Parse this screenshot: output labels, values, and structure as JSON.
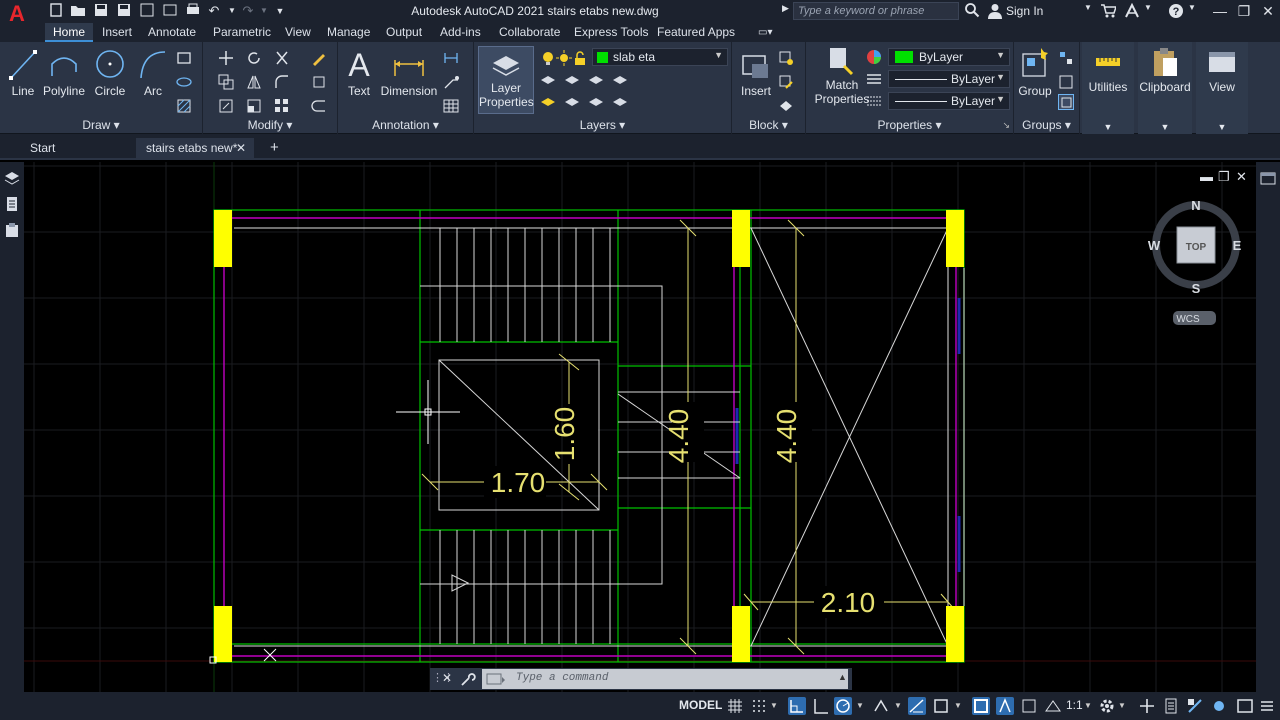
{
  "app": {
    "logo": "A",
    "title": "Autodesk AutoCAD 2021   stairs etabs new.dwg",
    "search_placeholder": "Type a keyword or phrase",
    "signin_label": "Sign In"
  },
  "ribbon_tabs": [
    "Home",
    "Insert",
    "Annotate",
    "Parametric",
    "View",
    "Manage",
    "Output",
    "Add-ins",
    "Collaborate",
    "Express Tools",
    "Featured Apps"
  ],
  "ribbon": {
    "draw": {
      "title": "Draw",
      "tools": [
        "Line",
        "Polyline",
        "Circle",
        "Arc"
      ]
    },
    "modify": {
      "title": "Modify"
    },
    "annotation": {
      "title": "Annotation",
      "text_label": "Text",
      "dimension_label": "Dimension"
    },
    "layers": {
      "title": "Layers",
      "layer_properties_line1": "Layer",
      "layer_properties_line2": "Properties",
      "current_layer": "slab eta"
    },
    "block": {
      "title": "Block",
      "insert_label": "Insert"
    },
    "properties": {
      "title": "Properties",
      "match_line1": "Match",
      "match_line2": "Properties",
      "color": "ByLayer",
      "linetype": "ByLayer",
      "lineweight": "ByLayer"
    },
    "groups": {
      "title": "Groups",
      "group_label": "Group"
    },
    "utilities_label": "Utilities",
    "clipboard_label": "Clipboard",
    "view_label": "View"
  },
  "doc_tabs": [
    "Start",
    "stairs etabs new*"
  ],
  "viewcube": {
    "north": "N",
    "south": "S",
    "east": "E",
    "west": "W",
    "face": "TOP",
    "wcs": "WCS"
  },
  "drawing": {
    "dims": [
      "1.60",
      "1.70",
      "4.40",
      "4.40",
      "2.10"
    ]
  },
  "command": {
    "placeholder": "Type a command"
  },
  "status": {
    "model_label": "MODEL",
    "scale_label": "1:1"
  },
  "colors": {
    "accent": "#2e6db0",
    "beam": "#ffff00",
    "wall": "#00c000",
    "edge": "#c000c0",
    "dim_text": "#e6e070"
  }
}
